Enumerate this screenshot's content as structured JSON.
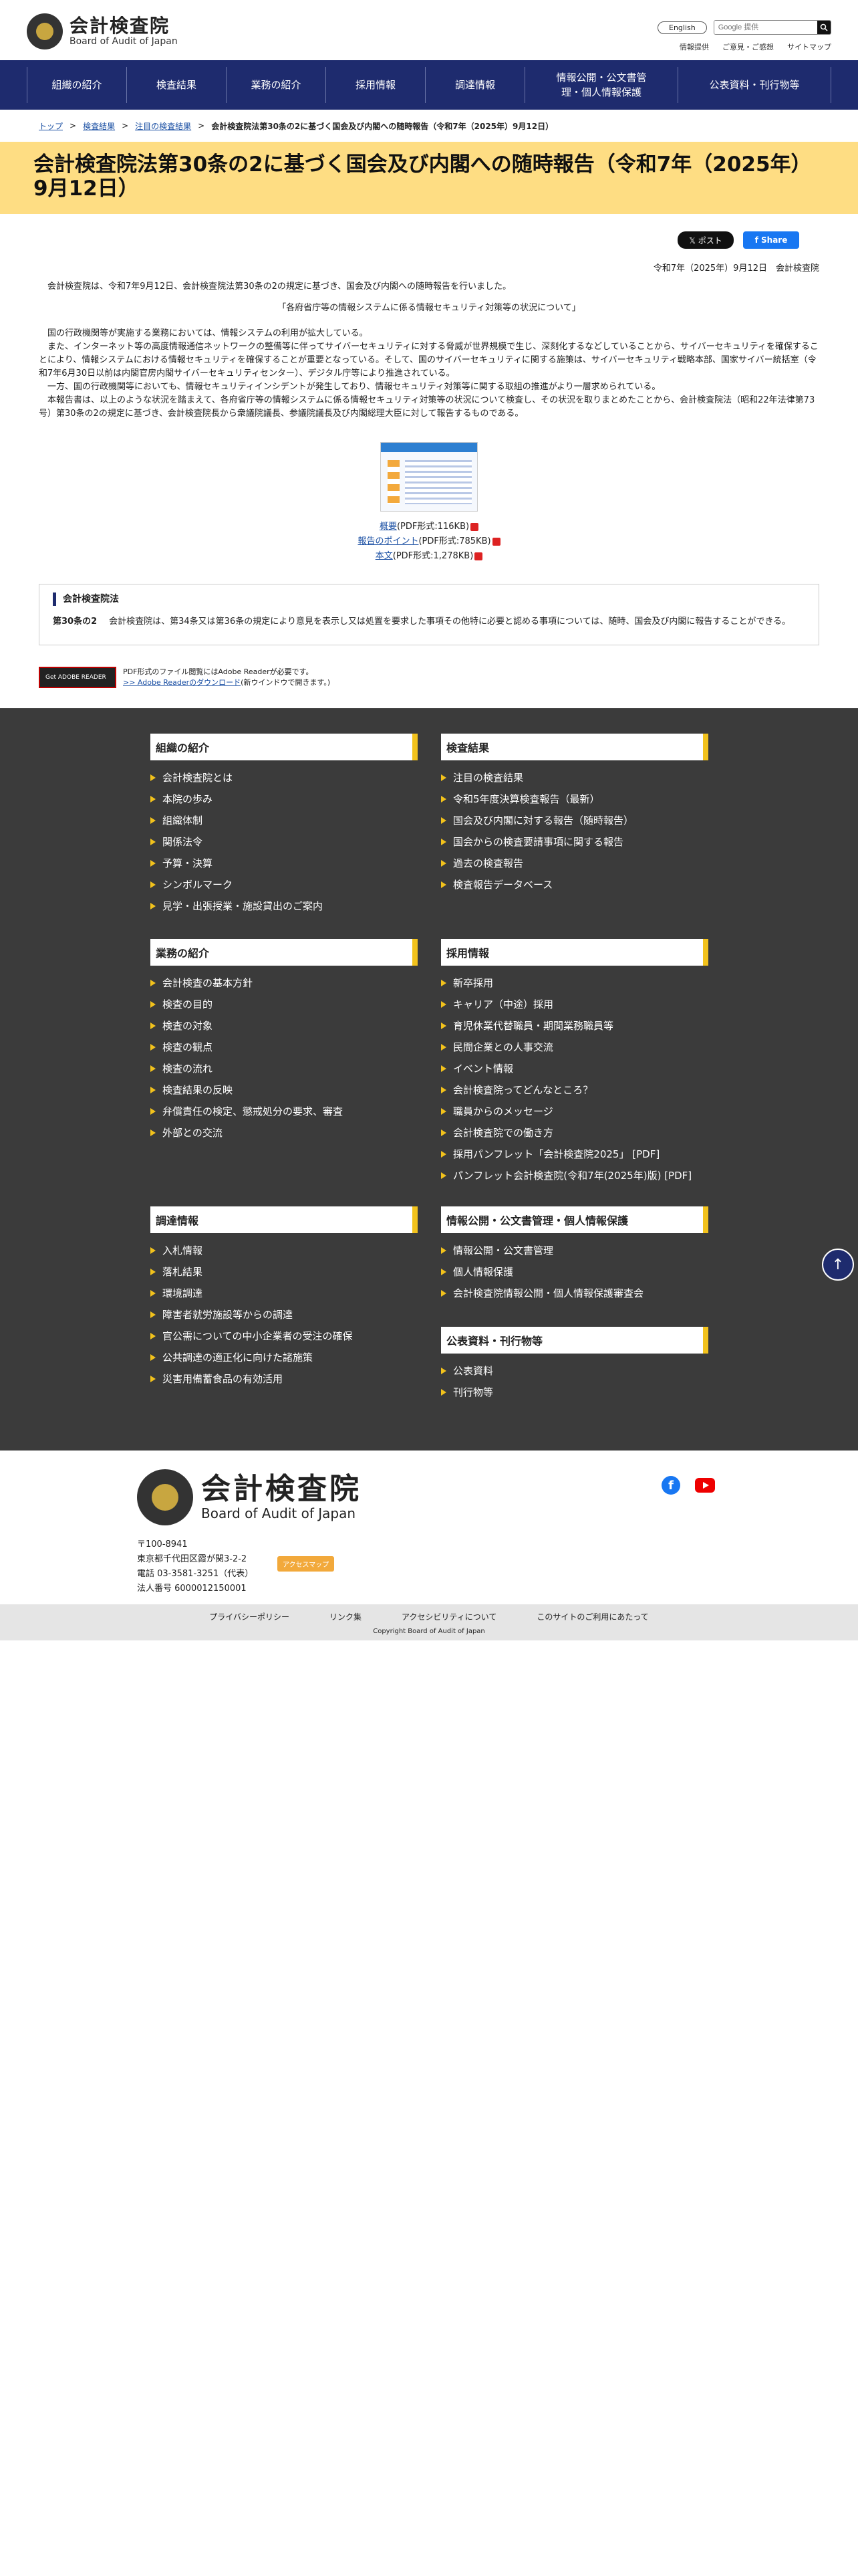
{
  "header": {
    "logo_ja": "会計検査院",
    "logo_en": "Board of Audit of Japan",
    "english_label": "English",
    "search_placeholder": "Google 提供",
    "links": [
      "情報提供",
      "ご意見・ご感想",
      "サイトマップ"
    ]
  },
  "nav": [
    "組織の紹介",
    "検査結果",
    "業務の紹介",
    "採用情報",
    "調達情報",
    "情報公開・公文書管理・個人情報保護",
    "公表資料・刊行物等"
  ],
  "breadcrumb": [
    "トップ",
    "検査結果",
    "注目の検査結果",
    "会計検査院法第30条の2に基づく国会及び内閣への随時報告（令和7年（2025年）9月12日）"
  ],
  "title": "会計検査院法第30条の2に基づく国会及び内閣への随時報告（令和7年（2025年）9月12日）",
  "social": {
    "x_label": "𝕏 ポスト",
    "fb_label": "f Share"
  },
  "date": "令和7年（2025年）9月12日　会計検査院",
  "intro": "会計検査院は、令和7年9月12日、会計検査院法第30条の2の規定に基づき、国会及び内閣への随時報告を行いました。",
  "report_title": "「各府省庁等の情報システムに係る情報セキュリティ対策等の状況について」",
  "paragraphs": [
    "国の行政機関等が実施する業務においては、情報システムの利用が拡大している。",
    "また、インターネット等の高度情報通信ネットワークの整備等に伴ってサイバーセキュリティに対する脅威が世界規模で生じ、深刻化するなどしていることから、サイバーセキュリティを確保することにより、情報システムにおける情報セキュリティを確保することが重要となっている。そして、国のサイバーセキュリティに関する施策は、サイバーセキュリティ戦略本部、国家サイバー統括室（令和7年6月30日以前は内閣官房内閣サイバーセキュリティセンター）、デジタル庁等により推進されている。",
    "一方、国の行政機関等においても、情報セキュリティインシデントが発生しており、情報セキュリティ対策等に関する取組の推進がより一層求められている。",
    "本報告書は、以上のような状況を踏まえて、各府省庁等の情報システムに係る情報セキュリティ対策等の状況について検査し、その状況を取りまとめたことから、会計検査院法（昭和22年法律第73号）第30条の2の規定に基づき、会計検査院長から衆議院議長、参議院議長及び内閣総理大臣に対して報告するものである。"
  ],
  "files": [
    {
      "link": "概要",
      "meta": "(PDF形式:116KB)"
    },
    {
      "link": "報告のポイント",
      "meta": "(PDF形式:785KB)"
    },
    {
      "link": "本文",
      "meta": "(PDF形式:1,278KB)"
    }
  ],
  "reference": {
    "heading": "会計検査院法",
    "article": "第30条の2",
    "text": "会計検査院は、第34条又は第36条の規定により意見を表示し又は処置を要求した事項その他特に必要と認める事項については、随時、国会及び内閣に報告することができる。"
  },
  "reader": {
    "badge": "Get ADOBE READER",
    "note": "PDF形式のファイル閲覧にはAdobe Readerが必要です。",
    "link": ">> Adobe Readerのダウンロード",
    "link_note": "(新ウインドウで開きます。)"
  },
  "footer_nav": [
    {
      "title": "組織の紹介",
      "items": [
        "会計検査院とは",
        "本院の歩み",
        "組織体制",
        "関係法令",
        "予算・決算",
        "シンボルマーク",
        "見学・出張授業・施設貸出のご案内"
      ]
    },
    {
      "title": "検査結果",
      "items": [
        "注目の検査結果",
        "令和5年度決算検査報告（最新）",
        "国会及び内閣に対する報告（随時報告）",
        "国会からの検査要請事項に関する報告",
        "過去の検査報告",
        "検査報告データベース"
      ]
    },
    {
      "title": "業務の紹介",
      "items": [
        "会計検査の基本方針",
        "検査の目的",
        "検査の対象",
        "検査の観点",
        "検査の流れ",
        "検査結果の反映",
        "弁償責任の検定、懲戒処分の要求、審査",
        "外部との交流"
      ]
    },
    {
      "title": "採用情報",
      "items": [
        "新卒採用",
        "キャリア（中途）採用",
        "育児休業代替職員・期間業務職員等",
        "民間企業との人事交流",
        "イベント情報",
        "会計検査院ってどんなところ？",
        "職員からのメッセージ",
        "会計検査院での働き方",
        "採用パンフレット「会計検査院2025」 [PDF]",
        "パンフレット会計検査院(令和7年(2025年)版) [PDF]"
      ]
    },
    {
      "title": "調達情報",
      "items": [
        "入札情報",
        "落札結果",
        "環境調達",
        "障害者就労施設等からの調達",
        "官公需についての中小企業者の受注の確保",
        "公共調達の適正化に向けた諸施策",
        "災害用備蓄食品の有効活用"
      ]
    },
    {
      "title": "情報公開・公文書管理・個人情報保護",
      "items": [
        "情報公開・公文書管理",
        "個人情報保護",
        "会計検査院情報公開・個人情報保護審査会"
      ]
    },
    {
      "title": "公表資料・刊行物等",
      "items": [
        "公表資料",
        "刊行物等"
      ]
    }
  ],
  "footer": {
    "logo_ja": "会計検査院",
    "logo_en": "Board of Audit of Japan",
    "address": [
      "〒100-8941",
      "東京都千代田区霞が関3-2-2",
      "電話 03-3581-3251（代表）",
      "法人番号 6000012150001"
    ],
    "access_label": "アクセスマップ",
    "links": [
      "プライバシーポリシー",
      "リンク集",
      "アクセシビリティについて",
      "このサイトのご利用にあたって"
    ],
    "copyright": "Copyright Board of Audit of Japan"
  }
}
